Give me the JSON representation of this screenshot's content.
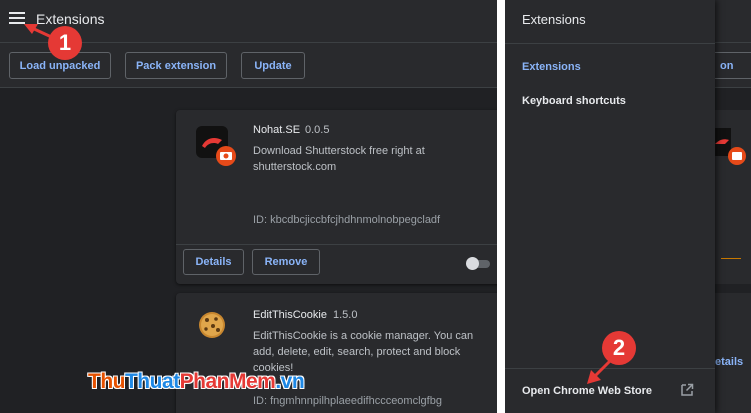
{
  "left": {
    "header": {
      "title": "Extensions"
    },
    "toolbar": {
      "load_unpacked": "Load unpacked",
      "pack_extension": "Pack extension",
      "update": "Update"
    },
    "extensions": [
      {
        "name": "Nohat.SE",
        "version": "0.0.5",
        "description": "Download Shutterstock free right at shutterstock.com",
        "id": "ID: kbcdbcjiccbfcjhdhnmolnobpegcladf",
        "details_label": "Details",
        "remove_label": "Remove",
        "enabled": false
      },
      {
        "name": "EditThisCookie",
        "version": "1.5.0",
        "description": "EditThisCookie is a cookie manager. You can add, delete, edit, search, protect and block cookies!",
        "id": "ID: fngmhnnpilhplaeedifhccceomclgfbg"
      }
    ]
  },
  "right": {
    "drawer": {
      "title": "Extensions",
      "items": [
        {
          "label": "Extensions",
          "active": true
        },
        {
          "label": "Keyboard shortcuts",
          "active": false
        }
      ],
      "footer_link": "Open Chrome Web Store"
    },
    "peek": {
      "button_fragment": "on",
      "details_fragment": "etails"
    }
  },
  "annotations": {
    "step1": "1",
    "step2": "2",
    "color": "#e53935"
  },
  "watermark": {
    "part1": "Thu",
    "part2": "Thuat",
    "part3": "PhanMem",
    "part4": ".vn"
  },
  "colors": {
    "background": "#202124",
    "surface": "#292a2d",
    "accent": "#8ab4f8",
    "text": "#e8eaed"
  }
}
